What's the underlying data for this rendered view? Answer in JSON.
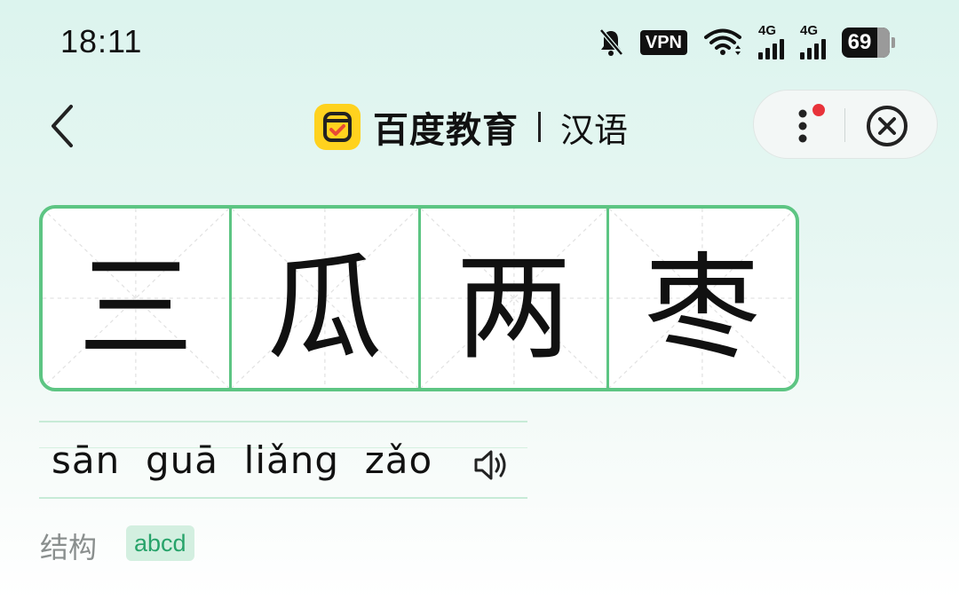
{
  "status_bar": {
    "time": "18:11",
    "vpn": "VPN",
    "network_1": "4G",
    "network_2": "4G",
    "battery": "69",
    "icons": [
      "bell-muted-icon",
      "vpn-icon",
      "wifi-icon",
      "signal-icon",
      "signal-icon",
      "battery-icon"
    ]
  },
  "nav": {
    "brand": "百度教育",
    "section": "汉语",
    "icons": [
      "back-arrow-icon",
      "more-vert-icon",
      "close-circle-icon"
    ],
    "notification_dot_color": "#e8333a"
  },
  "characters": [
    "三",
    "瓜",
    "两",
    "枣"
  ],
  "pinyin": "sān  guā  liǎng  zǎo",
  "structure": {
    "label": "结构",
    "value": "abcd"
  },
  "colors": {
    "accent_green": "#5dc583",
    "tag_text": "#27a36a",
    "logo_yellow": "#ffd21e"
  }
}
